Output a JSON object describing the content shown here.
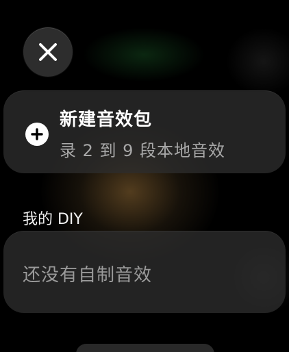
{
  "close": {
    "icon": "close-icon"
  },
  "new_pack": {
    "icon": "plus-circle-icon",
    "title": "新建音效包",
    "subtitle": "录 2 到 9 段本地音效"
  },
  "diy_section": {
    "heading": "我的 DIY",
    "empty_text": "还没有自制音效"
  },
  "colors": {
    "card_background": "#2d2d2d",
    "title_text": "#ffffff",
    "secondary_text": "#a8a8a8",
    "empty_text": "#9a9a9a"
  }
}
